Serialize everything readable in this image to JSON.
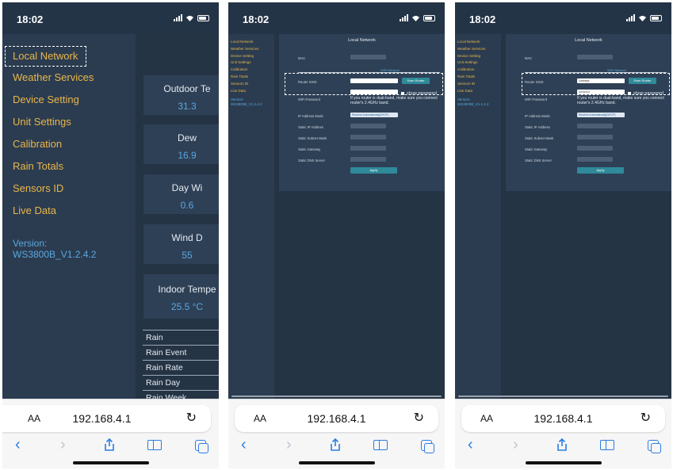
{
  "status_bar": {
    "time": "18:02"
  },
  "browser": {
    "aa_label": "AA",
    "url": "192.168.4.1",
    "reload_icon": "reload-icon",
    "toolbar_icons": [
      "back-icon",
      "forward-icon",
      "share-icon",
      "bookmarks-icon",
      "tabs-icon"
    ]
  },
  "nav": {
    "items": [
      "Local Network",
      "Weather Services",
      "Device Setting",
      "Unit Settings",
      "Calibration",
      "Rain Totals",
      "Sensors ID",
      "Live Data"
    ],
    "version_label": "Version:",
    "version_value": "WS3800B_V1.2.4.2",
    "version_short": "WS3800B_V1.2.4.2"
  },
  "live_cards": [
    {
      "title": "Outdoor Te",
      "value": "31.3"
    },
    {
      "title": "Dew",
      "value": "16.9"
    },
    {
      "title": "Day Wi",
      "value": "0.6"
    },
    {
      "title": "Wind D",
      "value": "55"
    },
    {
      "title": "Indoor Tempe",
      "value": "25.5 °C"
    }
  ],
  "rain_rows": [
    "Rain",
    "Rain Event",
    "Rain Rate",
    "Rain Day",
    "Rain Week"
  ],
  "local_network": {
    "title": "Local Network",
    "mac_label": "MAC",
    "wifi_section": "WiFi Network",
    "router_ssid_label": "Router SSID",
    "scan_button": "Scan Router",
    "wifi_password_label": "WiFi Password",
    "show_password": "show password",
    "dual_band_note": "If you router is dual-band, make sure you connect router's 2.4GHz band.",
    "ip_mode_label": "IP Address Mode",
    "ip_mode_value": "Receive Automatically(DHCP)",
    "static_ip_label": "Static IP Address",
    "subnet_label": "Static Subnet Mask",
    "gateway_label": "Static Gateway",
    "dns_label": "Static DNS Server",
    "apply_button": "Apply",
    "ssid_value_empty": "",
    "ssid_value_filled": "Linksys",
    "password_value_filled": "••••••••••"
  },
  "colors": {
    "accent_nav": "#e9b64a",
    "link_blue": "#5aa7e0",
    "panel": "#2e4056",
    "button": "#2f8a9a"
  }
}
